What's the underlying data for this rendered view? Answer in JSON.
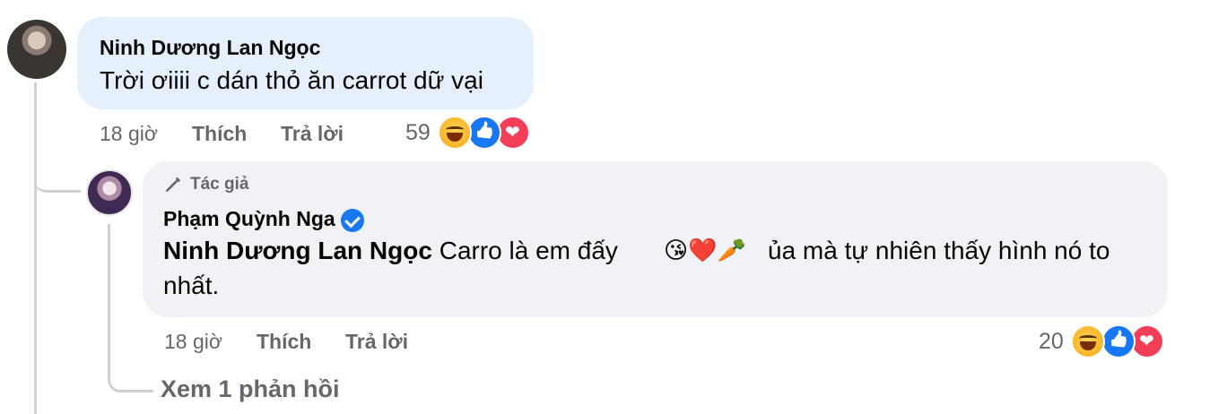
{
  "comment": {
    "author": "Ninh Dương Lan Ngọc",
    "text": "Trời ơiiii c dán thỏ ăn carrot dữ vại",
    "time": "18 giờ",
    "like_label": "Thích",
    "reply_label": "Trả lời",
    "reaction_count": "59"
  },
  "reply": {
    "badge": "Tác giả",
    "author": "Phạm Quỳnh Nga",
    "mention": "Ninh Dương Lan Ngọc",
    "text_line1": "Carro là em đấy",
    "emojis": "😘❤️🥕",
    "text_line1_end": "ủa mà tự nhiên thấy hình nó to",
    "text_line2": "nhất.",
    "time": "18 giờ",
    "like_label": "Thích",
    "reply_label": "Trả lời",
    "reaction_count": "20"
  },
  "view_more": "Xem 1 phản hồi",
  "icons": [
    "pencil-icon",
    "verified-badge-icon",
    "haha-reaction-icon",
    "like-reaction-icon",
    "love-reaction-icon"
  ],
  "colors": {
    "comment_bubble": "#e6f0fd",
    "reply_bubble": "#f0f2f5",
    "secondary_text": "#65676b",
    "verified": "#1877f2"
  }
}
